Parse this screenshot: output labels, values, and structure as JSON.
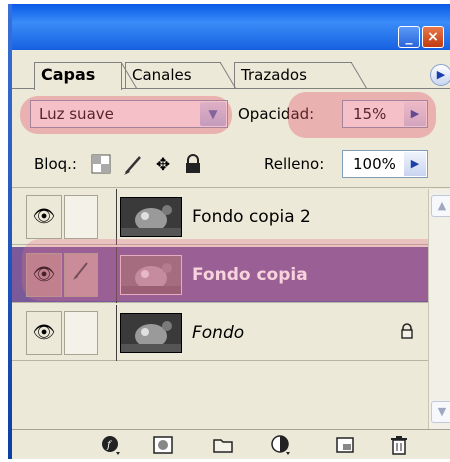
{
  "tabs": [
    {
      "label": "Capas",
      "active": true
    },
    {
      "label": "Canales",
      "active": false
    },
    {
      "label": "Trazados",
      "active": false
    }
  ],
  "blend_mode": {
    "value": "Luz suave"
  },
  "opacity": {
    "label": "Opacidad:",
    "value": "15%"
  },
  "lock": {
    "label": "Bloq.:"
  },
  "fill": {
    "label": "Relleno:",
    "value": "100%"
  },
  "layers": [
    {
      "name": "Fondo copia 2",
      "visible": true,
      "selected": false,
      "locked": false
    },
    {
      "name": "Fondo copia",
      "visible": true,
      "selected": true,
      "locked": false
    },
    {
      "name": "Fondo",
      "visible": true,
      "selected": false,
      "locked": true
    }
  ],
  "colors": {
    "titlebar": "#1660e0",
    "panel_bg": "#ece9d8",
    "selected_layer": "#7a5a9a",
    "highlight": "#e65a6e"
  }
}
